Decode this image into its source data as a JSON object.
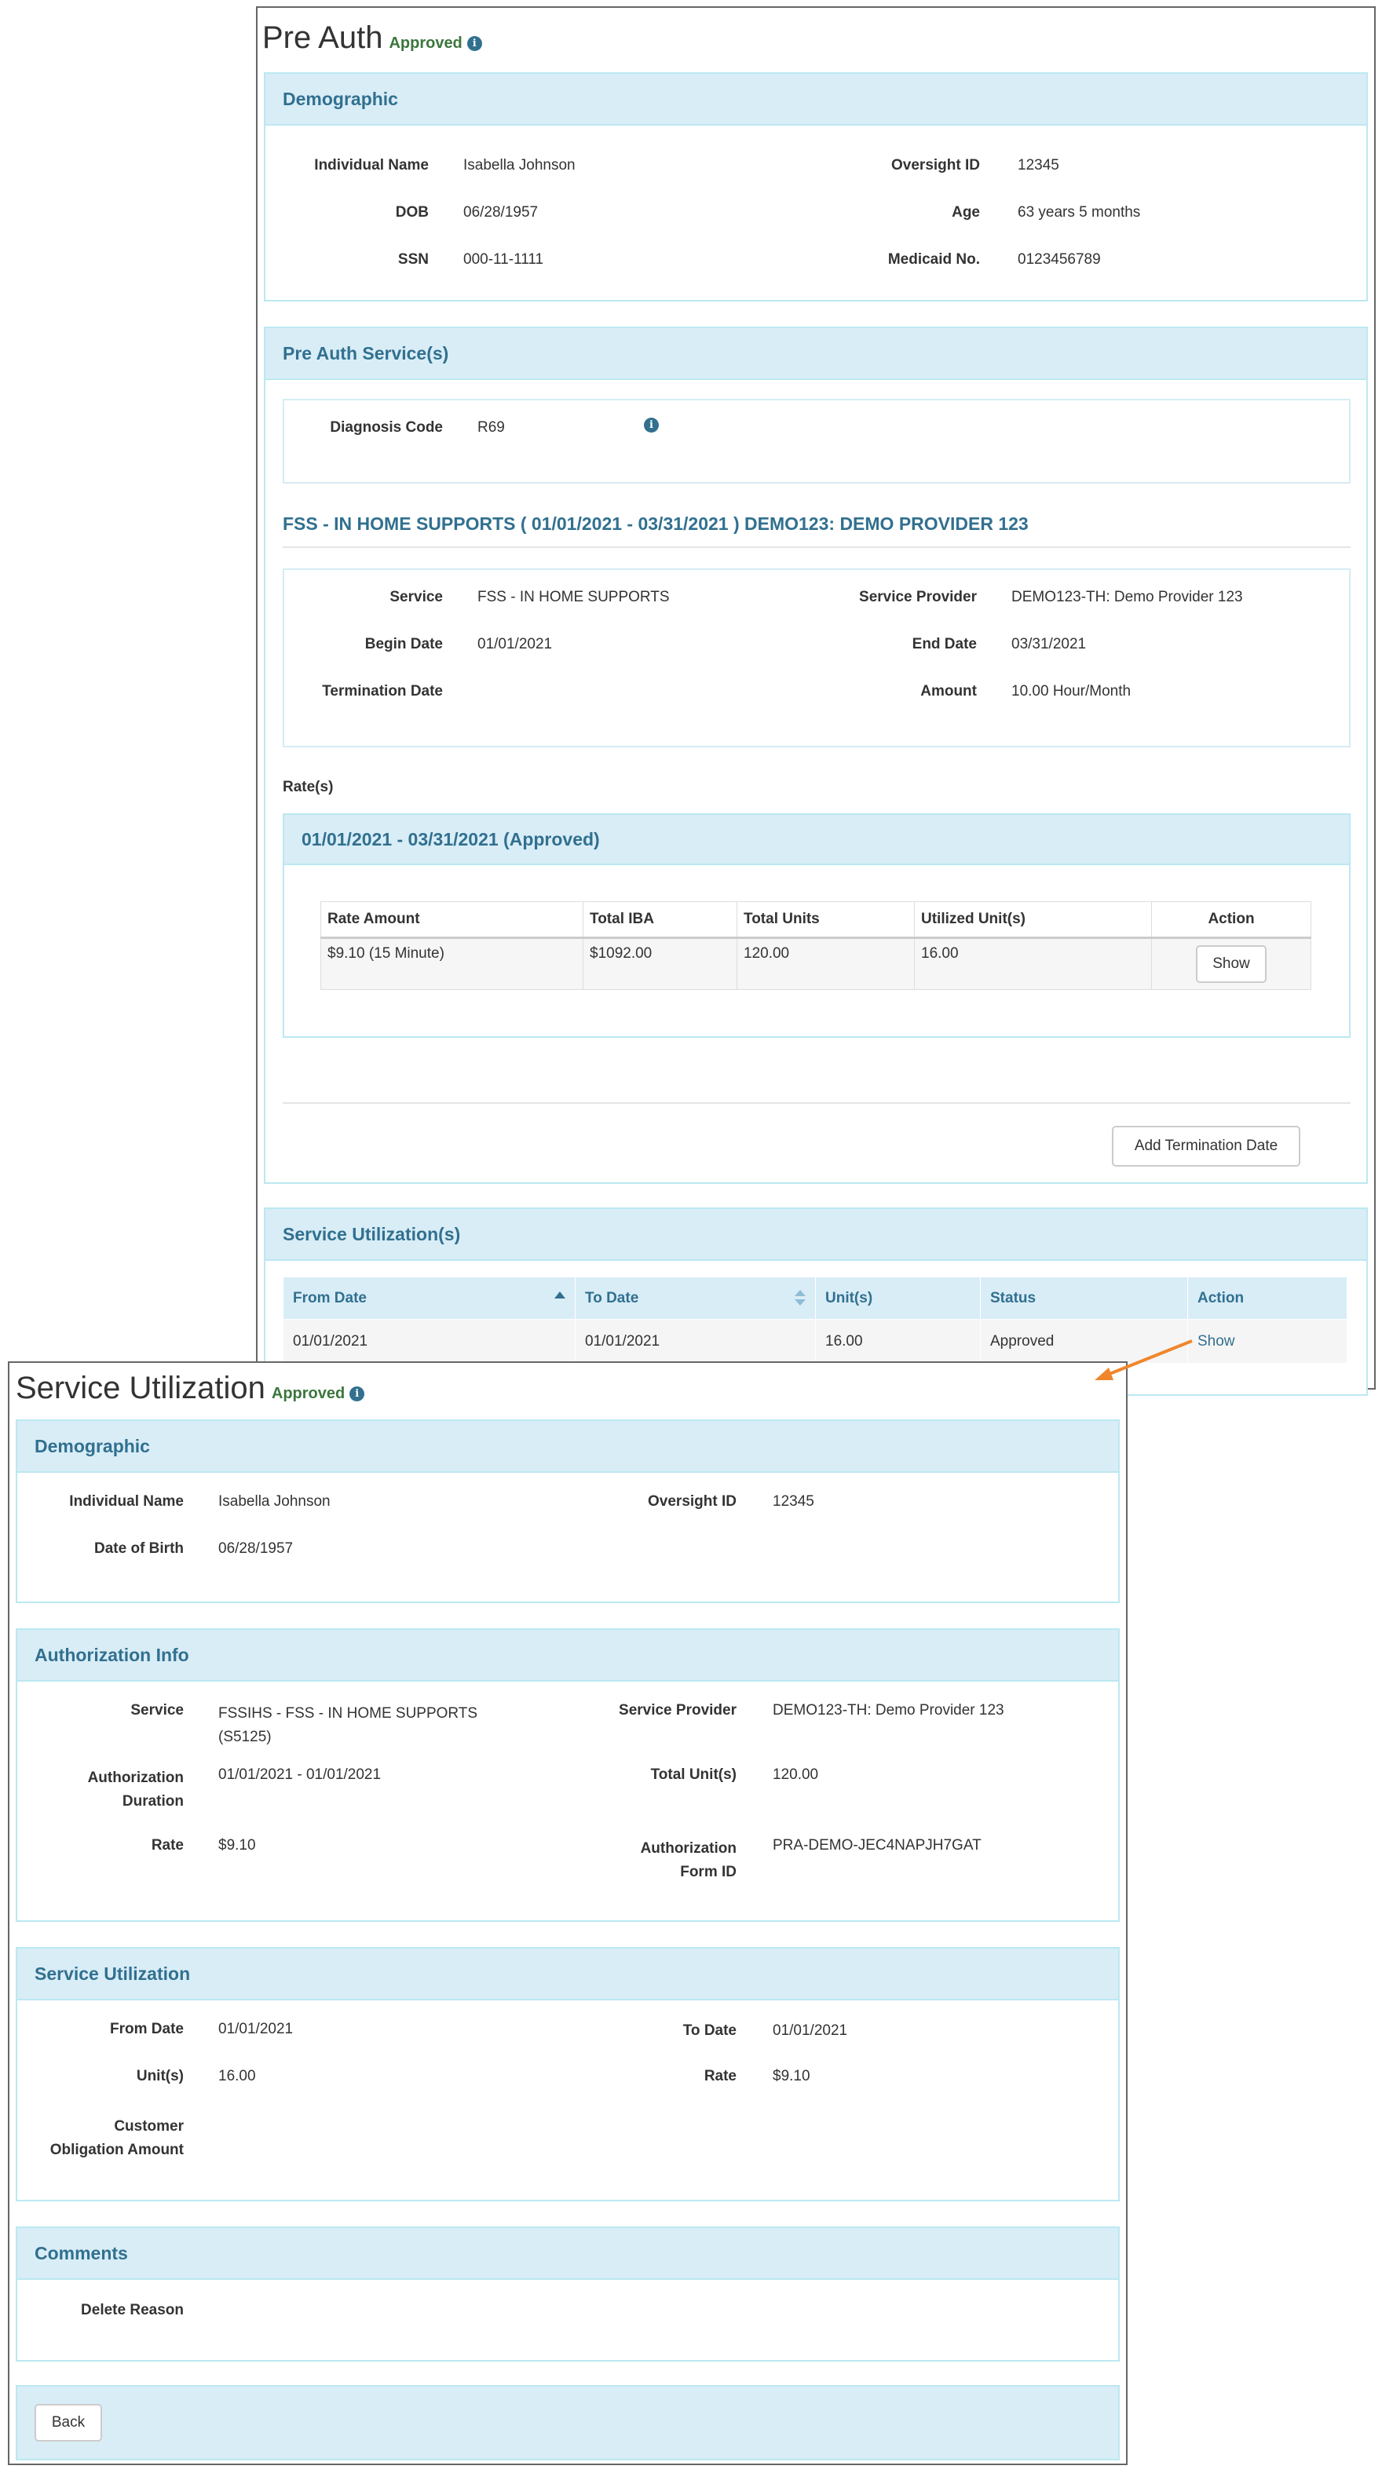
{
  "preauth": {
    "title": "Pre Auth",
    "status": "Approved",
    "demographic": {
      "heading": "Demographic",
      "name_label": "Individual Name",
      "name": "Isabella Johnson",
      "dob_label": "DOB",
      "dob": "06/28/1957",
      "ssn_label": "SSN",
      "ssn": "000-11-1111",
      "oversight_label": "Oversight ID",
      "oversight": "12345",
      "age_label": "Age",
      "age": "63 years 5 months",
      "medicaid_label": "Medicaid No.",
      "medicaid": "0123456789"
    },
    "services": {
      "heading": "Pre Auth Service(s)",
      "diagnosis_label": "Diagnosis Code",
      "diagnosis": "R69",
      "service_heading": "FSS - IN HOME SUPPORTS ( 01/01/2021 - 03/31/2021 ) DEMO123: DEMO PROVIDER 123",
      "service_label": "Service",
      "service": "FSS - IN HOME SUPPORTS",
      "begin_label": "Begin Date",
      "begin": "01/01/2021",
      "term_label": "Termination Date",
      "term": "",
      "provider_label": "Service Provider",
      "provider": "DEMO123-TH: Demo Provider 123",
      "end_label": "End Date",
      "end": "03/31/2021",
      "amount_label": "Amount",
      "amount": "10.00 Hour/Month",
      "rates_label": "Rate(s)",
      "rate_period": "01/01/2021 - 03/31/2021 (Approved)",
      "rate_columns": [
        "Rate Amount",
        "Total IBA",
        "Total Units",
        "Utilized Unit(s)",
        "Action"
      ],
      "rate_row": [
        "$9.10 (15 Minute)",
        "$1092.00",
        "120.00",
        "16.00"
      ],
      "show_label": "Show",
      "add_term_label": "Add Termination Date"
    },
    "utilizations": {
      "heading": "Service Utilization(s)",
      "columns": [
        "From Date",
        "To Date",
        "Unit(s)",
        "Status",
        "Action"
      ],
      "row": [
        "01/01/2021",
        "01/01/2021",
        "16.00",
        "Approved"
      ],
      "show_label": "Show"
    }
  },
  "su": {
    "title": "Service Utilization",
    "status": "Approved",
    "demographic": {
      "heading": "Demographic",
      "name_label": "Individual Name",
      "name": "Isabella Johnson",
      "dob_label": "Date of Birth",
      "dob": "06/28/1957",
      "oversight_label": "Oversight ID",
      "oversight": "12345"
    },
    "auth": {
      "heading": "Authorization Info",
      "service_label": "Service",
      "service_line1": "FSSIHS - FSS - IN HOME SUPPORTS",
      "service_line2": "(S5125)",
      "duration_label1": "Authorization",
      "duration_label2": "Duration",
      "duration": "01/01/2021 - 01/01/2021",
      "rate_label": "Rate",
      "rate": "$9.10",
      "provider_label": "Service Provider",
      "provider": "DEMO123-TH: Demo Provider 123",
      "units_label": "Total Unit(s)",
      "units": "120.00",
      "form_label1": "Authorization",
      "form_label2": "Form ID",
      "form": "PRA-DEMO-JEC4NAPJH7GAT"
    },
    "util": {
      "heading": "Service Utilization",
      "from_label": "From Date",
      "from": "01/01/2021",
      "units_label": "Unit(s)",
      "units": "16.00",
      "obligation_label1": "Customer",
      "obligation_label2": "Obligation Amount",
      "obligation": "",
      "to_label": "To Date",
      "to": "01/01/2021",
      "rate_label": "Rate",
      "rate": "$9.10"
    },
    "comments": {
      "heading": "Comments",
      "delete_label": "Delete Reason",
      "delete": ""
    },
    "back_label": "Back"
  },
  "colors": {
    "panel_heading_bg": "#d9edf7",
    "panel_heading_text": "#31708f",
    "panel_border": "#bce8f1",
    "approved": "#3c763d",
    "arrow": "#f0862c"
  },
  "icons": [
    "info-icon",
    "sort-asc-icon",
    "sort-both-icon",
    "arrow-icon"
  ]
}
